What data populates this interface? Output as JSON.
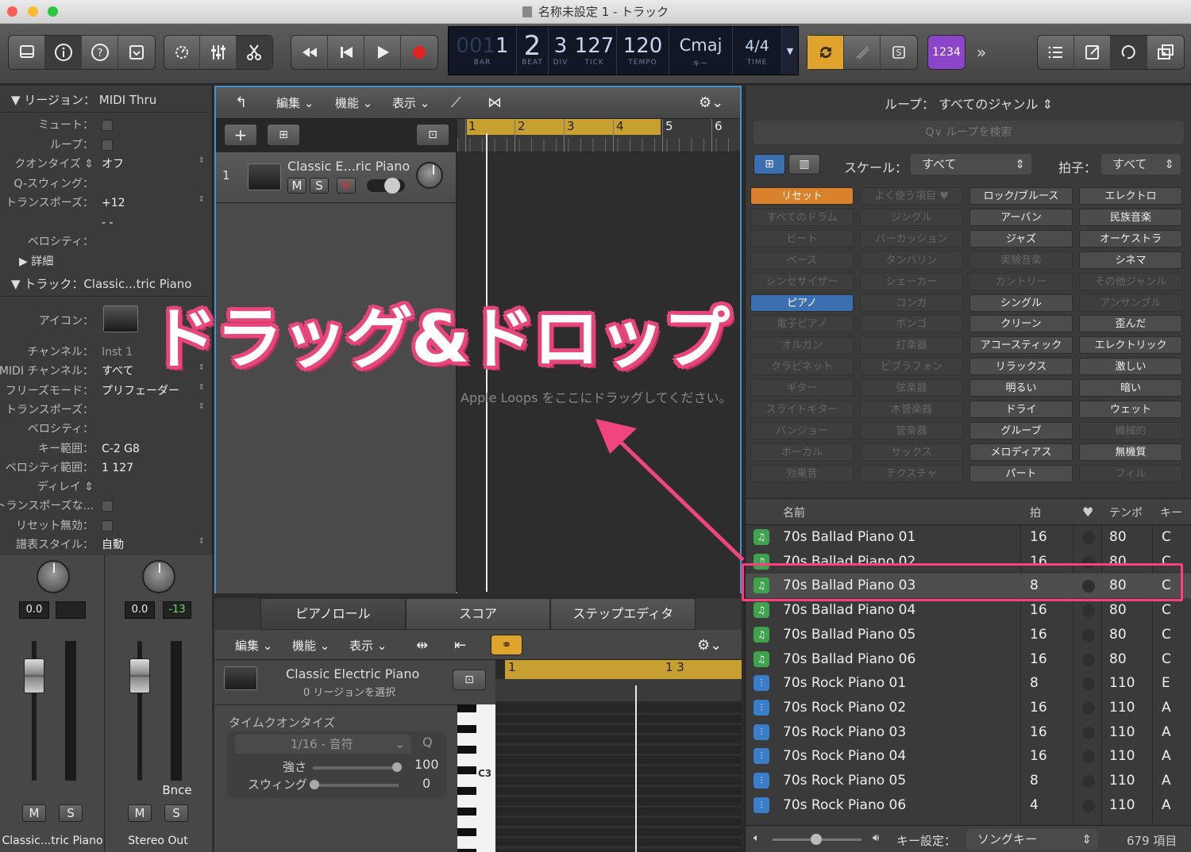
{
  "window": {
    "title": "名称未設定 1 - トラック"
  },
  "lcd": {
    "bar": "001",
    "bar_digit": "1",
    "beat": "2",
    "div": "3",
    "tick": "127",
    "tempo": "120",
    "key": "Cmaj",
    "sig_top": "4",
    "sig_bottom": "4",
    "labels": {
      "bar": "BAR",
      "beat": "BEAT",
      "div": "DIV",
      "tick": "TICK",
      "tempo": "TEMPO",
      "key": "キー",
      "time": "TIME"
    }
  },
  "toolbar": {
    "count_in": "1234",
    "more": "»"
  },
  "inspector": {
    "region_header": "リージョン：  MIDI Thru",
    "region_rows": [
      {
        "label": "ミュート：",
        "value": "",
        "check": true
      },
      {
        "label": "ループ：",
        "value": "",
        "check": true
      },
      {
        "label": "クオンタイズ ⇕",
        "value": "オフ",
        "check": false
      },
      {
        "label": "Q-スウィング：",
        "value": "",
        "check": false
      },
      {
        "label": "トランスポーズ：",
        "value": "+12",
        "check": false
      },
      {
        "label": "",
        "value": "- -",
        "check": false
      },
      {
        "label": "ベロシティ：",
        "value": "",
        "check": false
      },
      {
        "label": "▶ 詳細",
        "value": "",
        "check": false
      }
    ],
    "track_header": "トラック：Classic...tric Piano",
    "icon_label": "アイコン：",
    "track_rows": [
      {
        "label": "チャンネル：",
        "value": "Inst 1"
      },
      {
        "label": "MIDI チャンネル：",
        "value": "すべて"
      },
      {
        "label": "フリーズモード：",
        "value": "プリフェーダー"
      },
      {
        "label": "トランスポーズ：",
        "value": ""
      },
      {
        "label": "ベロシティ：",
        "value": ""
      },
      {
        "label": "キー範囲：",
        "value": "C-2     G8"
      },
      {
        "label": "ベロシティ範囲：",
        "value": "1     127"
      },
      {
        "label": "ディレイ ⇕",
        "value": ""
      },
      {
        "label": "トランスポーズな...",
        "value": ""
      },
      {
        "label": "リセット無効：",
        "value": ""
      },
      {
        "label": "譜表スタイル：",
        "value": "自動"
      }
    ]
  },
  "strips": [
    {
      "vol": "0.0",
      "pan": "",
      "m": "M",
      "s": "S",
      "name": "Classic...tric Piano",
      "extra": ""
    },
    {
      "vol": "0.0",
      "pan": "-13",
      "m": "M",
      "s": "S",
      "name": "Stereo Out",
      "extra": "Bnce"
    }
  ],
  "tracks": {
    "menus": [
      "編集",
      "機能",
      "表示"
    ],
    "ruler": [
      "1",
      "2",
      "3",
      "4",
      "5",
      "6"
    ],
    "track_number": "1",
    "track_name": "Classic E...ric Piano",
    "mute": "M",
    "solo": "S",
    "rec": "R",
    "drop_hint": "Apple Loops をここにドラッグしてください。"
  },
  "editor": {
    "tabs": [
      "ピアノロール",
      "スコア",
      "ステップエディタ"
    ],
    "menus": [
      "編集",
      "機能",
      "表示"
    ],
    "track_name": "Classic Electric Piano",
    "selection": "0 リージョンを選択",
    "ruler": [
      "1",
      "1 3"
    ],
    "time_quantize": "タイムクオンタイズ",
    "quant_value": "1/16 - 音符",
    "q": "Q",
    "strength_label": "強さ",
    "strength_value": "100",
    "swing_label": "スウィング",
    "swing_value": "0",
    "c3": "C3"
  },
  "loops": {
    "header": "ループ：  すべてのジャンル",
    "search_placeholder": "Q∨ ループを検索",
    "scale_label": "スケール：",
    "scale_value": "すべて",
    "sig_label": "拍子：",
    "sig_value": "すべて",
    "keywords": [
      [
        "リセット",
        "よく使う項目 ♥",
        "ロック/ブルース",
        "エレクトロ"
      ],
      [
        "すべてのドラム",
        "ジングル",
        "アーバン",
        "民族音楽"
      ],
      [
        "ビート",
        "パーカッション",
        "ジャズ",
        "オーケストラ"
      ],
      [
        "ベース",
        "タンバリン",
        "実験音楽",
        "シネマ"
      ],
      [
        "シンセサイザー",
        "シェーカー",
        "カントリー",
        "その他ジャンル"
      ],
      [
        "ピアノ",
        "コンガ",
        "シングル",
        "アンサンブル"
      ],
      [
        "電子ピアノ",
        "ボンゴ",
        "クリーン",
        "歪んだ"
      ],
      [
        "オルガン",
        "打楽器",
        "アコースティック",
        "エレクトリック"
      ],
      [
        "クラビネット",
        "ビブラフォン",
        "リラックス",
        "激しい"
      ],
      [
        "ギター",
        "弦楽器",
        "明るい",
        "暗い"
      ],
      [
        "スライドギター",
        "木管楽器",
        "ドライ",
        "ウェット"
      ],
      [
        "バンジョー",
        "管楽器",
        "グルーブ",
        "機械的"
      ],
      [
        "ボーカル",
        "サックス",
        "メロディアス",
        "無機質"
      ],
      [
        "効果音",
        "テクスチャ",
        "パート",
        "フィル"
      ]
    ],
    "kw_active": [
      [
        1,
        0,
        1,
        1
      ],
      [
        0,
        0,
        1,
        1
      ],
      [
        0,
        0,
        1,
        1
      ],
      [
        0,
        0,
        0,
        1
      ],
      [
        0,
        0,
        0,
        0
      ],
      [
        1,
        0,
        1,
        0
      ],
      [
        0,
        0,
        1,
        1
      ],
      [
        0,
        0,
        1,
        1
      ],
      [
        0,
        0,
        1,
        1
      ],
      [
        0,
        0,
        1,
        1
      ],
      [
        0,
        0,
        1,
        1
      ],
      [
        0,
        0,
        1,
        0
      ],
      [
        0,
        0,
        1,
        1
      ],
      [
        0,
        0,
        1,
        0
      ]
    ],
    "columns": {
      "name": "名前",
      "beats": "拍",
      "tempo": "テンポ",
      "key": "キー"
    },
    "rows": [
      {
        "name": "70s Ballad Piano 01",
        "beats": "16",
        "tempo": "80",
        "key": "C",
        "kind": "midi"
      },
      {
        "name": "70s Ballad Piano 02",
        "beats": "16",
        "tempo": "80",
        "key": "C",
        "kind": "midi"
      },
      {
        "name": "70s Ballad Piano 03",
        "beats": "8",
        "tempo": "80",
        "key": "C",
        "kind": "midi"
      },
      {
        "name": "70s Ballad Piano 04",
        "beats": "16",
        "tempo": "80",
        "key": "C",
        "kind": "midi"
      },
      {
        "name": "70s Ballad Piano 05",
        "beats": "16",
        "tempo": "80",
        "key": "C",
        "kind": "midi"
      },
      {
        "name": "70s Ballad Piano 06",
        "beats": "16",
        "tempo": "80",
        "key": "C",
        "kind": "midi"
      },
      {
        "name": "70s Rock Piano 01",
        "beats": "8",
        "tempo": "110",
        "key": "E",
        "kind": "audio"
      },
      {
        "name": "70s Rock Piano 02",
        "beats": "16",
        "tempo": "110",
        "key": "A",
        "kind": "audio"
      },
      {
        "name": "70s Rock Piano 03",
        "beats": "16",
        "tempo": "110",
        "key": "A",
        "kind": "audio"
      },
      {
        "name": "70s Rock Piano 04",
        "beats": "16",
        "tempo": "110",
        "key": "A",
        "kind": "audio"
      },
      {
        "name": "70s Rock Piano 05",
        "beats": "8",
        "tempo": "110",
        "key": "A",
        "kind": "audio"
      },
      {
        "name": "70s Rock Piano 06",
        "beats": "4",
        "tempo": "110",
        "key": "A",
        "kind": "audio"
      }
    ],
    "key_label": "キー設定：",
    "key_value": "ソングキー",
    "count": "679 項目"
  },
  "annotation": {
    "text": "ドラッグ&ドロップ",
    "color": "#e8457a"
  },
  "colors": {
    "accent": "#4a90c8",
    "cycle": "#c8a032",
    "midi_icon": "#3fa34d",
    "audio_icon": "#3a7dc8",
    "keyword_active": "#3a6fb0",
    "reset": "#d9822b"
  }
}
